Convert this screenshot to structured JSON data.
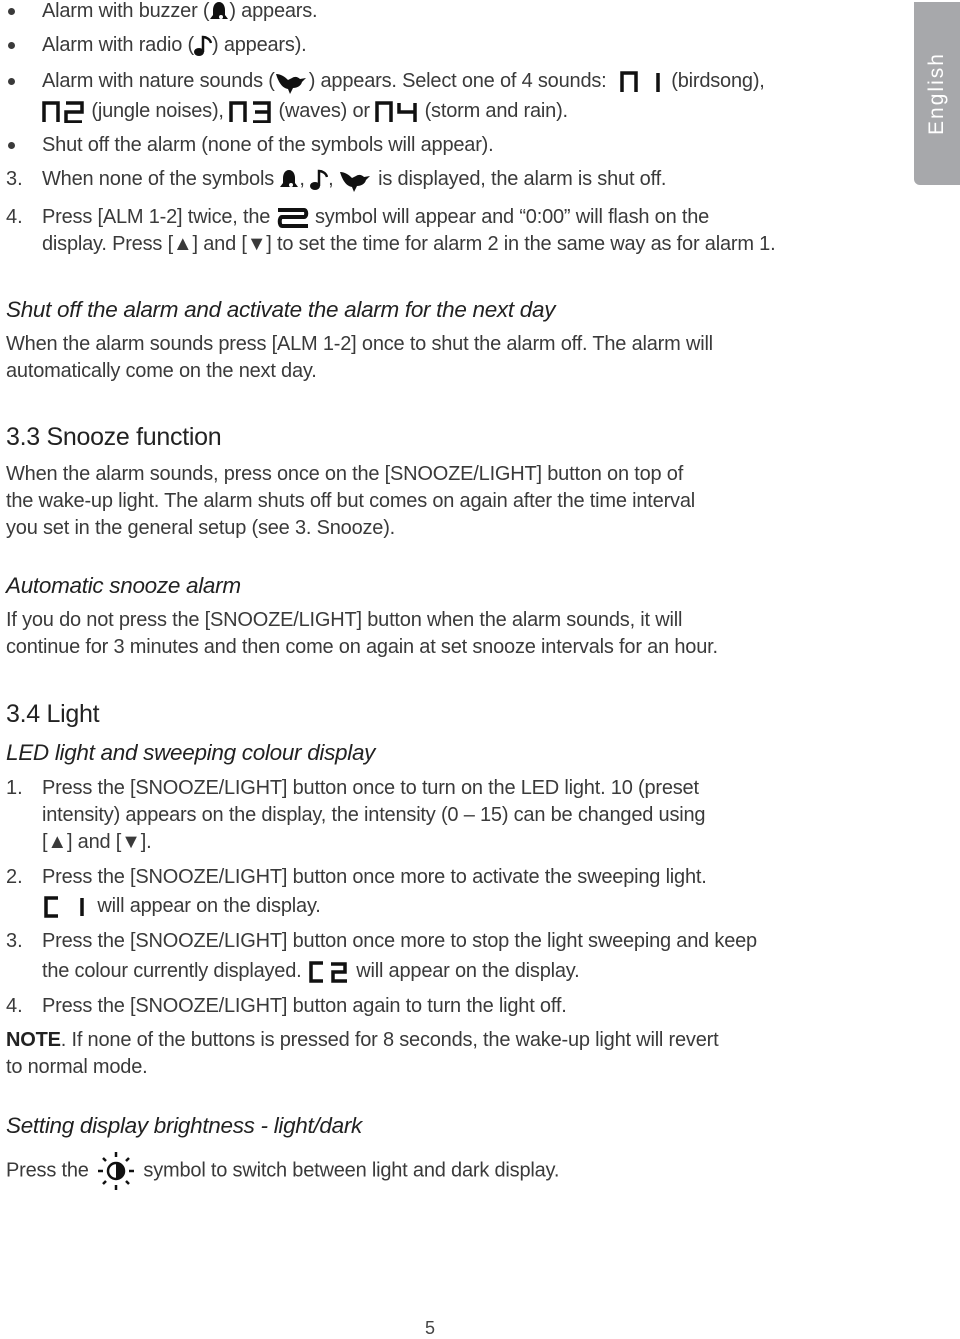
{
  "side_tab": {
    "label": "English"
  },
  "alarm_modes": {
    "buzzer": {
      "pre": "Alarm with buzzer (",
      "icon": "bell-icon",
      "post": ") appears."
    },
    "radio": {
      "pre": "Alarm with radio (",
      "icon": "music-note-icon",
      "post": ") appears)."
    },
    "nature": {
      "pre": "Alarm with nature sounds (",
      "icon": "bird-icon",
      "post": ") appears. Select one of 4 sounds:",
      "sounds": [
        {
          "code": "n1",
          "label": "(birdsong),"
        },
        {
          "code": "n2",
          "label": "(jungle noises),"
        },
        {
          "code": "n3",
          "label": "(waves) or"
        },
        {
          "code": "n4",
          "label": "(storm and rain)."
        }
      ]
    },
    "off": {
      "text": "Shut off the alarm (none of the symbols will appear)."
    }
  },
  "steps_alarm": [
    {
      "num": "3.",
      "pre": "When none of the symbols",
      "post": "is displayed, the alarm is shut off."
    },
    {
      "num": "4.",
      "pre": "Press [ALM 1-2] twice, the",
      "mid": "symbol will appear and “0:00” will flash on the",
      "line2": "display. Press [▲] and [▼] to set the time for alarm 2 in the same way as for alarm 1."
    }
  ],
  "shutoff_section": {
    "title": "Shut off the alarm and activate the alarm for the next day",
    "lines": [
      "When the alarm sounds press [ALM 1-2] once to shut the alarm off. The alarm will",
      "automatically come on the next day."
    ]
  },
  "snooze_section": {
    "title": "3.3 Snooze function",
    "lines": [
      "When the alarm sounds, press once on the [SNOOZE/LIGHT] button on top of",
      "the wake-up light. The alarm shuts off but comes on again after the time interval",
      "you set in the general setup (see 3. Snooze)."
    ]
  },
  "auto_snooze_section": {
    "title": "Automatic snooze alarm",
    "lines": [
      "If you do not press the [SNOOZE/LIGHT] button when the alarm sounds, it will",
      "continue for 3 minutes and then come on again at set snooze intervals for an hour."
    ]
  },
  "light_section": {
    "title": "3.4 Light",
    "subtitle": "LED light and sweeping colour display",
    "steps": [
      {
        "num": "1.",
        "lines": [
          "Press the [SNOOZE/LIGHT] button once to turn on the LED light. 10 (preset",
          "intensity) appears on the display, the intensity (0 – 15) can be changed using",
          "[▲] and [▼]."
        ]
      },
      {
        "num": "2.",
        "lines": [
          "Press the [SNOOZE/LIGHT] button once more to activate the sweeping light."
        ],
        "code": "C1",
        "code_text": "will appear on the display."
      },
      {
        "num": "3.",
        "lines": [
          "Press the [SNOOZE/LIGHT] button once more to stop the light sweeping and keep"
        ],
        "pre2": "the colour currently displayed.",
        "code": "C2",
        "code_text": "will appear on the display."
      },
      {
        "num": "4.",
        "lines": [
          "Press the [SNOOZE/LIGHT] button again to turn the light off."
        ]
      }
    ],
    "note_label": "NOTE",
    "note_lines": [
      ". If none of the buttons is pressed for 8 seconds, the wake-up light will revert",
      "to normal mode."
    ]
  },
  "brightness_section": {
    "title": "Setting display brightness - light/dark",
    "pre": "Press the",
    "icon": "brightness-icon",
    "post": "symbol to switch between light and dark display."
  },
  "page_number": "5"
}
